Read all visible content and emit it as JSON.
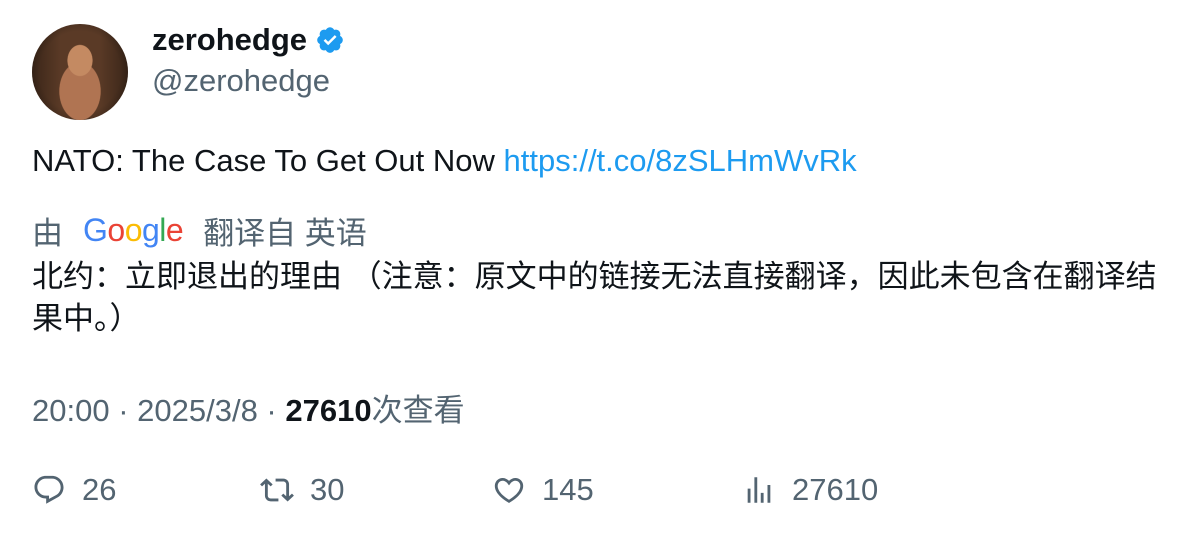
{
  "author": {
    "display_name": "zerohedge",
    "handle": "@zerohedge",
    "verified_icon": "verified-badge-icon",
    "avatar": "avatar"
  },
  "tweet": {
    "text": "NATO: The Case To Get Out Now ",
    "link": "https://t.co/8zSLHmWvRk"
  },
  "translation": {
    "prefix": "由",
    "provider_logo": "Google",
    "suffix": "翻译自 英语",
    "text": "北约：立即退出的理由 （注意：原文中的链接无法直接翻译，因此未包含在翻译结果中。）"
  },
  "meta": {
    "time": "20:00",
    "separator": " · ",
    "date": "2025/3/8",
    "views_count": "27610",
    "views_label": "次查看"
  },
  "actions": {
    "replies": "26",
    "retweets": "30",
    "likes": "145",
    "views": "27610"
  },
  "colors": {
    "link": "#1d9bf0",
    "secondary_text": "#536471",
    "primary_text": "#0f1419",
    "verified": "#1d9bf0"
  }
}
